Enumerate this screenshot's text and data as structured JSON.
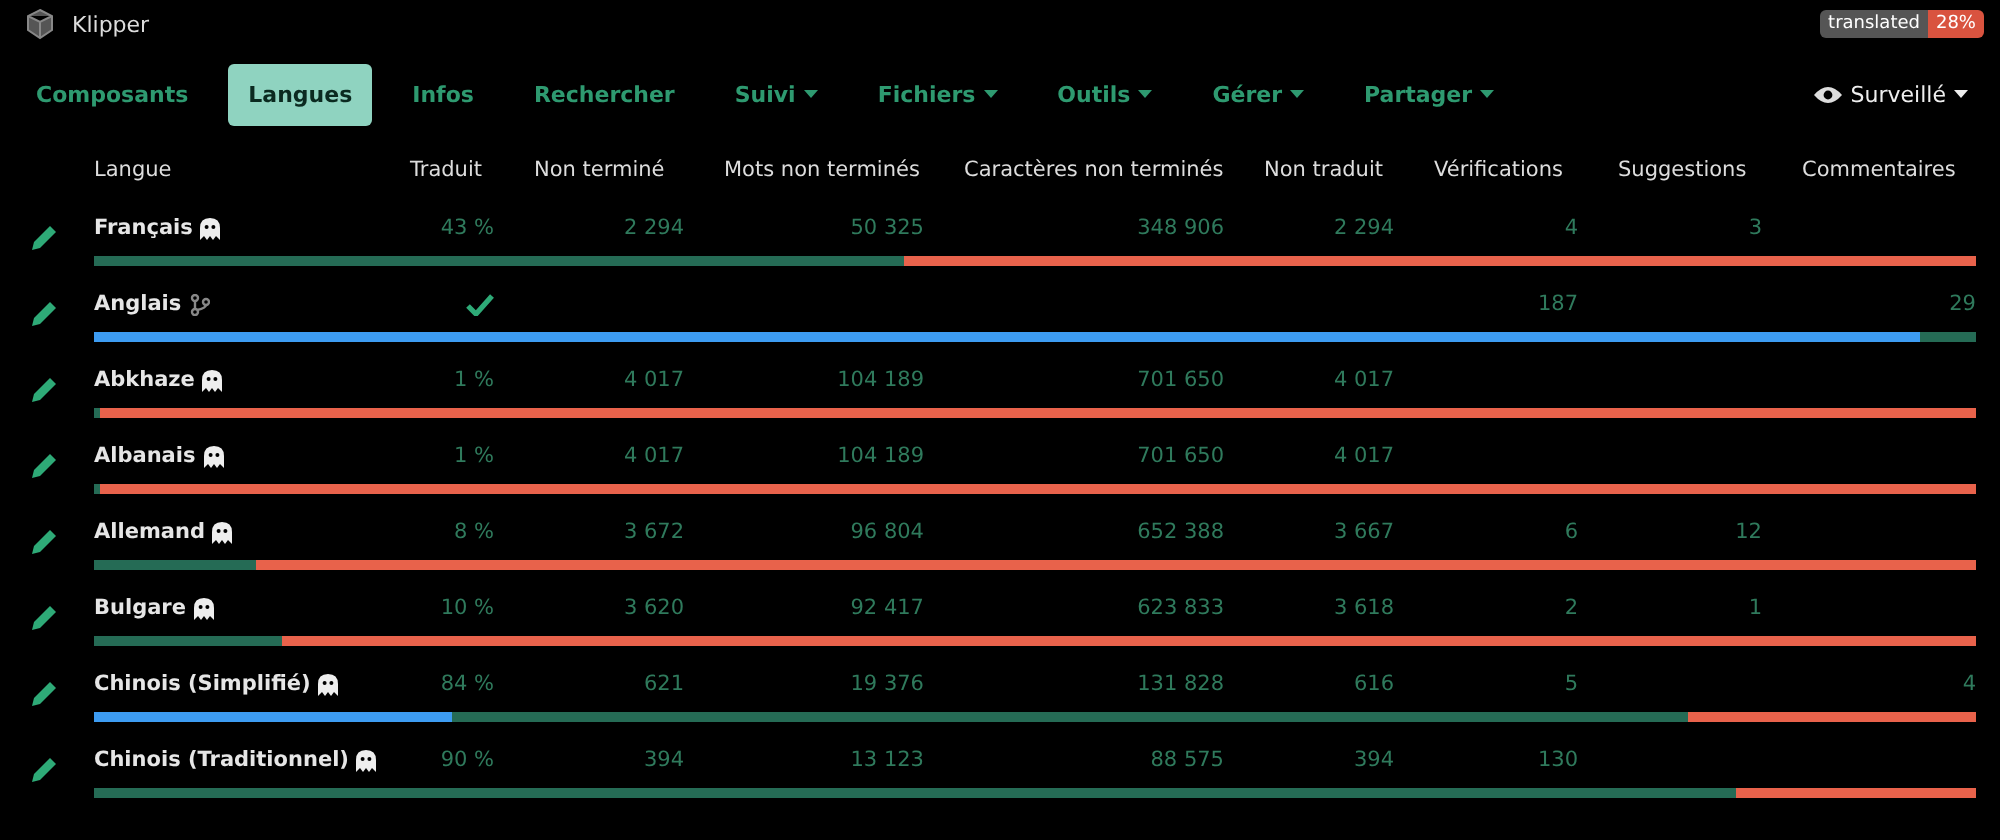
{
  "header": {
    "project": "Klipper",
    "badge": {
      "label": "translated",
      "value": "28%"
    }
  },
  "tabs": [
    {
      "label": "Composants",
      "selected": false,
      "dropdown": false
    },
    {
      "label": "Langues",
      "selected": true,
      "dropdown": false
    },
    {
      "label": "Infos",
      "selected": false,
      "dropdown": false
    },
    {
      "label": "Rechercher",
      "selected": false,
      "dropdown": false
    },
    {
      "label": "Suivi",
      "selected": false,
      "dropdown": true
    },
    {
      "label": "Fichiers",
      "selected": false,
      "dropdown": true
    },
    {
      "label": "Outils",
      "selected": false,
      "dropdown": true
    },
    {
      "label": "Gérer",
      "selected": false,
      "dropdown": true
    },
    {
      "label": "Partager",
      "selected": false,
      "dropdown": true
    }
  ],
  "watch": {
    "label": "Surveillé"
  },
  "table": {
    "columns": [
      "Langue",
      "Traduit",
      "Non terminé",
      "Mots non terminés",
      "Caractères non terminés",
      "Non traduit",
      "Vérifications",
      "Suggestions",
      "Commentaires"
    ],
    "rows": [
      {
        "name": "Français",
        "kind": "translation",
        "translated": "43 %",
        "unfinished": "2 294",
        "unfinished_words": "50 325",
        "unfinished_chars": "348 906",
        "untranslated": "2 294",
        "checks": "4",
        "suggestions": "3",
        "bar": [
          {
            "kind": "translated",
            "level": 0.43
          }
        ]
      },
      {
        "name": "Anglais",
        "kind": "source",
        "checks": "187",
        "comments": "29",
        "bar": [
          {
            "kind": "translated",
            "level": 1
          },
          {
            "kind": "approved",
            "level": 0.97
          }
        ]
      },
      {
        "name": "Abkhaze",
        "kind": "translation",
        "translated": "1 %",
        "unfinished": "4 017",
        "unfinished_words": "104 189",
        "unfinished_chars": "701 650",
        "untranslated": "4 017",
        "bar": [
          {
            "kind": "translated",
            "level": 0.003
          }
        ]
      },
      {
        "name": "Albanais",
        "kind": "translation",
        "translated": "1 %",
        "unfinished": "4 017",
        "unfinished_words": "104 189",
        "unfinished_chars": "701 650",
        "untranslated": "4 017",
        "bar": [
          {
            "kind": "translated",
            "level": 0.003
          }
        ]
      },
      {
        "name": "Allemand",
        "kind": "translation",
        "translated": "8 %",
        "unfinished": "3 672",
        "unfinished_words": "96 804",
        "unfinished_chars": "652 388",
        "untranslated": "3 667",
        "checks": "6",
        "suggestions": "12",
        "bar": [
          {
            "kind": "translated",
            "level": 0.086
          }
        ]
      },
      {
        "name": "Bulgare",
        "kind": "translation",
        "translated": "10 %",
        "unfinished": "3 620",
        "unfinished_words": "92 417",
        "unfinished_chars": "623 833",
        "untranslated": "3 618",
        "checks": "2",
        "suggestions": "1",
        "bar": [
          {
            "kind": "translated",
            "level": 0.1
          }
        ]
      },
      {
        "name": "Chinois (Simplifié)",
        "kind": "translation",
        "translated": "84 %",
        "unfinished": "621",
        "unfinished_words": "19 376",
        "unfinished_chars": "131 828",
        "untranslated": "616",
        "checks": "5",
        "comments": "4",
        "bar": [
          {
            "kind": "translated",
            "level": 0.847
          },
          {
            "kind": "approved",
            "level": 0.19
          }
        ]
      },
      {
        "name": "Chinois (Traditionnel)",
        "kind": "translation",
        "translated": "90 %",
        "unfinished": "394",
        "unfinished_words": "13 123",
        "unfinished_chars": "88 575",
        "untranslated": "394",
        "checks": "130",
        "bar": [
          {
            "kind": "translated",
            "level": 0.873
          }
        ]
      }
    ]
  }
}
